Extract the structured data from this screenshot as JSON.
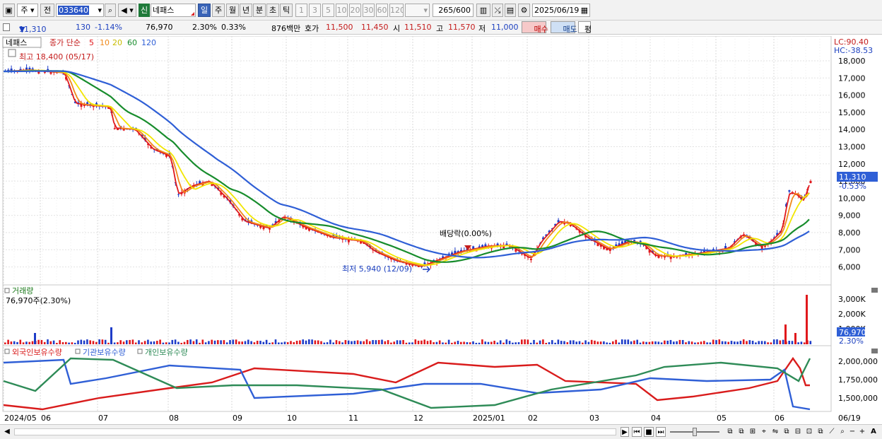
{
  "toolbar": {
    "market": "주",
    "prev": "전",
    "code": "033640",
    "search_icon": "search-icon",
    "sound_icon": "speaker-icon",
    "badge_new": "신",
    "name": "네패스",
    "periods": [
      "일",
      "주",
      "월",
      "년",
      "분",
      "초",
      "틱"
    ],
    "active_period": "일",
    "intervals": [
      "1",
      "3",
      "5",
      "10",
      "20",
      "30",
      "60",
      "120"
    ],
    "count": "265",
    "count_total": "/600",
    "date": "2025/06/19"
  },
  "quote": {
    "price": "11,310",
    "arrow": "▼",
    "change": "130",
    "change_pct": "-1.14%",
    "volume": "76,970",
    "vol_pct1": "2.30%",
    "vol_pct2": "0.33%",
    "amount": "876백만",
    "ask_label": "호가",
    "ask1": "11,500",
    "ask2": "11,450",
    "open_label": "시",
    "open": "11,510",
    "high_label": "고",
    "high": "11,570",
    "low_label": "저",
    "low": "11,000",
    "buy": "매수",
    "sell": "매도",
    "eval": "평"
  },
  "price_panel": {
    "name_tag": "네패스",
    "legend_prefix": "종가 단순",
    "ma_periods": [
      "5",
      "10",
      "20",
      "60",
      "120"
    ],
    "ma_colors": [
      "#e0181c",
      "#f08a1c",
      "#f2e600",
      "#178c2c",
      "#2f5fd6"
    ],
    "high_label": "최고 18,400 (05/17)",
    "low_label": "최저 5,940 (12/09)",
    "dividend_label": "배당락(0.00%)",
    "lc": "LC:90.40",
    "hc": "HC:-38.53",
    "y_ticks": [
      "18,000",
      "17,000",
      "16,000",
      "15,000",
      "14,000",
      "13,000",
      "12,000",
      "11,000",
      "10,000",
      "9,000",
      "8,000",
      "7,000",
      "6,000"
    ],
    "current_price": "11,310",
    "current_change": "-0.53%"
  },
  "volume_panel": {
    "title": "거래량",
    "value_label": "76,970주(2.30%)",
    "y_ticks": [
      "3,000K",
      "2,000K",
      "1,000K"
    ],
    "current": "76,970",
    "current_pct": "2.30%"
  },
  "holding_panel": {
    "legend": [
      "외국인보유수량",
      "기관보유수량",
      "개인보유수량"
    ],
    "legend_colors": [
      "#d91c1c",
      "#2f5fd6",
      "#2e8b57"
    ],
    "y_ticks": [
      "2,000,000",
      "1,750,000",
      "1,500,000"
    ]
  },
  "x_axis": [
    "2024/05",
    "06",
    "07",
    "08",
    "09",
    "10",
    "11",
    "12",
    "2025/01",
    "02",
    "03",
    "04",
    "05",
    "06"
  ],
  "x_axis_end": "06/19"
}
